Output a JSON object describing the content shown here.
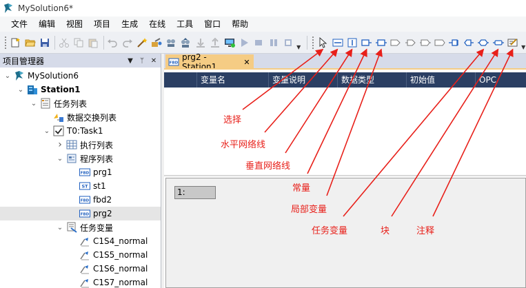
{
  "title": "MySolution6*",
  "menu": [
    "文件",
    "编辑",
    "视图",
    "项目",
    "生成",
    "在线",
    "工具",
    "窗口",
    "帮助"
  ],
  "project_panel": {
    "title": "项目管理器",
    "tree": [
      {
        "label": "MySolution6",
        "level": 0,
        "toggle": "expanded",
        "icon": "solution-icon"
      },
      {
        "label": "Station1",
        "level": 1,
        "toggle": "expanded",
        "icon": "station-icon",
        "bold": true
      },
      {
        "label": "任务列表",
        "level": 2,
        "toggle": "expanded",
        "icon": "task-list-icon"
      },
      {
        "label": "数据交换列表",
        "level": 3,
        "toggle": "none",
        "icon": "data-exchange-icon"
      },
      {
        "label": "T0:Task1",
        "level": 3,
        "toggle": "expanded",
        "icon": "task-checkbox-icon"
      },
      {
        "label": "执行列表",
        "level": 4,
        "toggle": "collapsed",
        "icon": "exec-list-icon"
      },
      {
        "label": "程序列表",
        "level": 4,
        "toggle": "expanded",
        "icon": "program-list-icon"
      },
      {
        "label": "prg1",
        "level": 5,
        "toggle": "none",
        "icon": "fbd-icon",
        "badge": "FBD"
      },
      {
        "label": "st1",
        "level": 5,
        "toggle": "none",
        "icon": "st-icon",
        "badge": "ST"
      },
      {
        "label": "fbd2",
        "level": 5,
        "toggle": "none",
        "icon": "fbd-icon",
        "badge": "FBD"
      },
      {
        "label": "prg2",
        "level": 5,
        "toggle": "none",
        "icon": "fbd-icon",
        "badge": "FBD",
        "selected": true
      },
      {
        "label": "任务变量",
        "level": 4,
        "toggle": "expanded",
        "icon": "task-variable-icon"
      },
      {
        "label": "C1S4_normal",
        "level": 5,
        "toggle": "none",
        "icon": "variable-icon"
      },
      {
        "label": "C1S5_normal",
        "level": 5,
        "toggle": "none",
        "icon": "variable-icon"
      },
      {
        "label": "C1S6_normal",
        "level": 5,
        "toggle": "none",
        "icon": "variable-icon"
      },
      {
        "label": "C1S7_normal",
        "level": 5,
        "toggle": "none",
        "icon": "variable-icon"
      }
    ]
  },
  "editor": {
    "tab_label": "prg2 - Station1",
    "columns": [
      "变量名",
      "变量说明",
      "数据类型",
      "初始值",
      "OPC"
    ],
    "line_label": "1:"
  },
  "annotations": [
    {
      "label": "选择",
      "target": "select-tool"
    },
    {
      "label": "水平网络线",
      "target": "horizontal-line-tool"
    },
    {
      "label": "垂直网络线",
      "target": "vertical-line-tool"
    },
    {
      "label": "常量",
      "target": "constant-tool"
    },
    {
      "label": "局部变量",
      "target": "local-variable-tool"
    },
    {
      "label": "任务变量",
      "target": "task-variable-tool"
    },
    {
      "label": "块",
      "target": "block-tool"
    },
    {
      "label": "注释",
      "target": "comment-tool"
    }
  ],
  "colors": {
    "annotation": "#e8201a",
    "tab_active": "#f5cc84",
    "grid_header": "#2b3f63",
    "panel_header": "#d6dbe9",
    "fbd_blue": "#1f5fbf"
  }
}
